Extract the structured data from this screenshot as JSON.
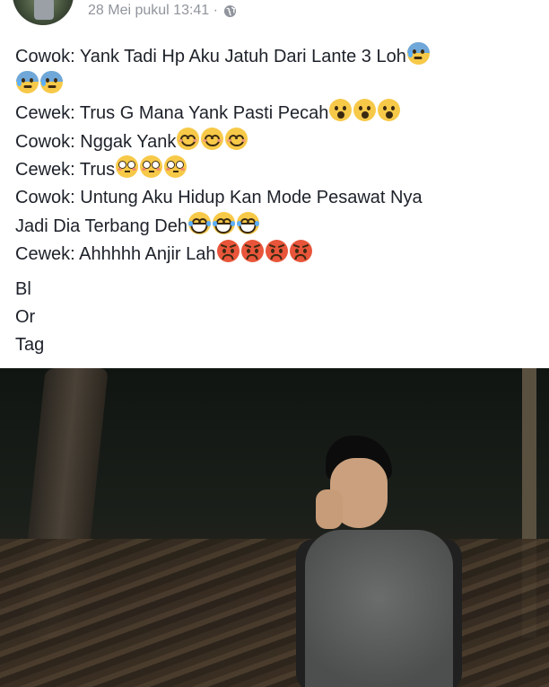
{
  "post": {
    "timestamp": "28 Mei pukul 13:41 ·",
    "audience_icon": "globe-icon",
    "lines": [
      {
        "text": "Cowok: Yank Tadi Hp Aku Jatuh Dari Lante 3 Loh",
        "emojis": [
          "anxious-sweat"
        ]
      },
      {
        "text": "",
        "emojis": [
          "anxious-sweat",
          "anxious-sweat"
        ]
      },
      {
        "text": "Cewek: Trus G Mana Yank Pasti Pecah",
        "emojis": [
          "shocked",
          "shocked",
          "shocked"
        ]
      },
      {
        "text": "Cowok: Nggak Yank",
        "emojis": [
          "smile",
          "smile",
          "smile"
        ]
      },
      {
        "text": "Cewek: Trus",
        "emojis": [
          "flushed",
          "flushed",
          "flushed"
        ]
      },
      {
        "text": "Cowok: Untung Aku Hidup Kan Mode Pesawat Nya",
        "emojis": []
      },
      {
        "text": "Jadi Dia Terbang Deh",
        "emojis": [
          "laugh-tears",
          "laugh-tears",
          "laugh-tears"
        ]
      },
      {
        "text": "Cewek: Ahhhhh Anjir Lah",
        "emojis": [
          "angry",
          "angry",
          "angry",
          "angry"
        ]
      }
    ],
    "tags": [
      "Bl",
      "Or",
      "Tag"
    ]
  },
  "colors": {
    "text": "#1d2129",
    "meta_text": "#90949c",
    "background": "#ffffff"
  }
}
